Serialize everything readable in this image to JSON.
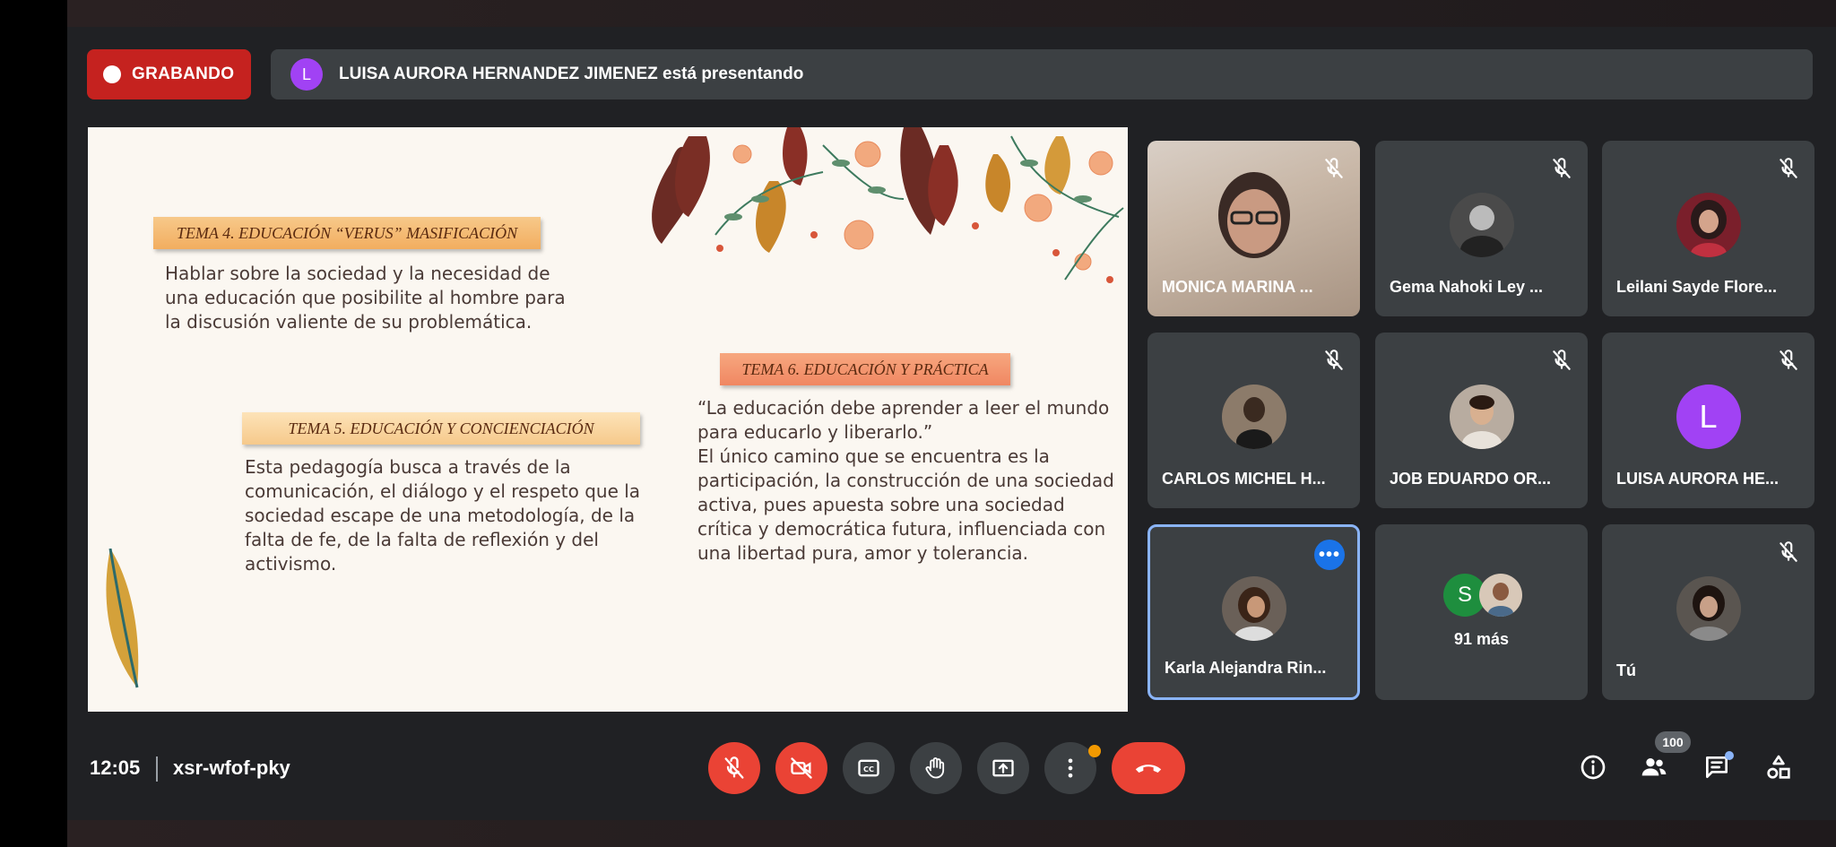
{
  "header": {
    "recording_label": "GRABANDO",
    "presenter_initial": "L",
    "presenting_text": "LUISA AURORA HERNANDEZ JIMENEZ está presentando"
  },
  "slide": {
    "topic4_title": "TEMA 4. EDUCACIÓN “VERUS” MASIFICACIÓN",
    "topic4_text": "Hablar sobre la sociedad y la necesidad de una educación que posibilite al hombre para la discusión valiente de su problemática.",
    "topic5_title": "TEMA 5. EDUCACIÓN Y CONCIENCIACIÓN",
    "topic5_text": "Esta pedagogía busca a través de la comunicación, el diálogo y el respeto que la sociedad escape de una metodología, de la falta de fe, de la falta de reflexión y del activismo.",
    "topic6_title": "TEMA 6. EDUCACIÓN Y PRÁCTICA",
    "topic6_quote": "“La educación debe aprender a leer el mundo para educarlo y liberarlo.”",
    "topic6_text": "El único camino que se encuentra es la participación, la construcción de una sociedad activa, pues apuesta sobre una sociedad crítica y democrática futura, influenciada con una libertad pura, amor y tolerancia."
  },
  "participants": [
    {
      "name": "MONICA MARINA ...",
      "muted": true
    },
    {
      "name": "Gema Nahoki Ley ...",
      "muted": true
    },
    {
      "name": "Leilani Sayde Flore...",
      "muted": true
    },
    {
      "name": "CARLOS MICHEL H...",
      "muted": true
    },
    {
      "name": "JOB EDUARDO OR...",
      "muted": true
    },
    {
      "name": "LUISA AURORA HE...",
      "muted": true,
      "initial": "L"
    },
    {
      "name": "Karla Alejandra Rin...",
      "muted": false,
      "more": "•••"
    },
    {
      "name": "91 más",
      "initial": "S"
    },
    {
      "name": "Tú",
      "muted": true
    }
  ],
  "bottom_bar": {
    "time": "12:05",
    "meeting_code": "xsr-wfof-pky",
    "controls": [
      "mic-off",
      "camera-off",
      "captions",
      "raise-hand",
      "present",
      "more-options",
      "leave-call"
    ],
    "people_count": "100"
  },
  "colors": {
    "recording": "#c5221f",
    "danger": "#ea4335",
    "tile_bg": "#3c4043",
    "active_border": "#8ab4f8",
    "purple_avatar": "#a142f4",
    "green_avatar": "#1e8e3e"
  }
}
